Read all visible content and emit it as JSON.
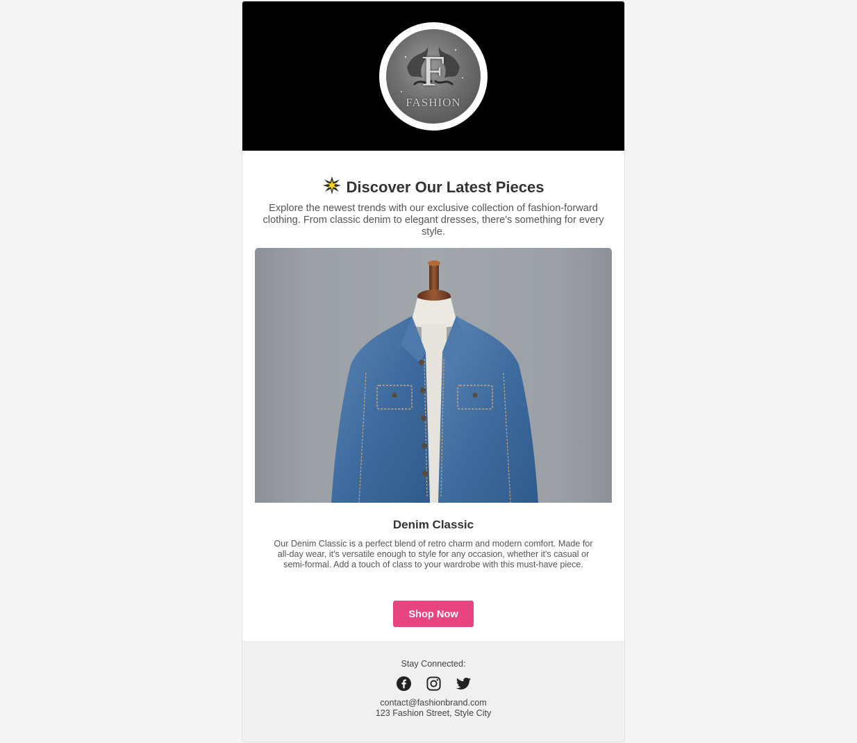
{
  "header": {
    "logo": {
      "letter": "F",
      "word": "FASHION"
    }
  },
  "main": {
    "headline_icon": "sparkle-star-icon",
    "headline": "Discover Our Latest Pieces",
    "intro": "Explore the newest trends with our exclusive collection of fashion-forward clothing. From classic denim to elegant dresses, there's something for every style."
  },
  "product": {
    "image": "denim-jacket-on-mannequin",
    "title": "Denim Classic",
    "description": "Our Denim Classic is a perfect blend of retro charm and modern comfort. Made for all-day wear, it's versatile enough to style for any occasion, whether it's casual or semi-formal. Add a touch of class to your wardrobe with this must-have piece."
  },
  "cta": {
    "label": "Shop Now",
    "color": "#e8447f"
  },
  "footer": {
    "stay_connected": "Stay Connected:",
    "socials": [
      "facebook-icon",
      "instagram-icon",
      "twitter-icon"
    ],
    "email": "contact@fashionbrand.com",
    "address": "123 Fashion Street, Style City"
  },
  "colors": {
    "page_bg": "#f4f4f4",
    "header_bg": "#000000",
    "footer_bg": "#f0f0f0",
    "accent": "#e8447f"
  }
}
